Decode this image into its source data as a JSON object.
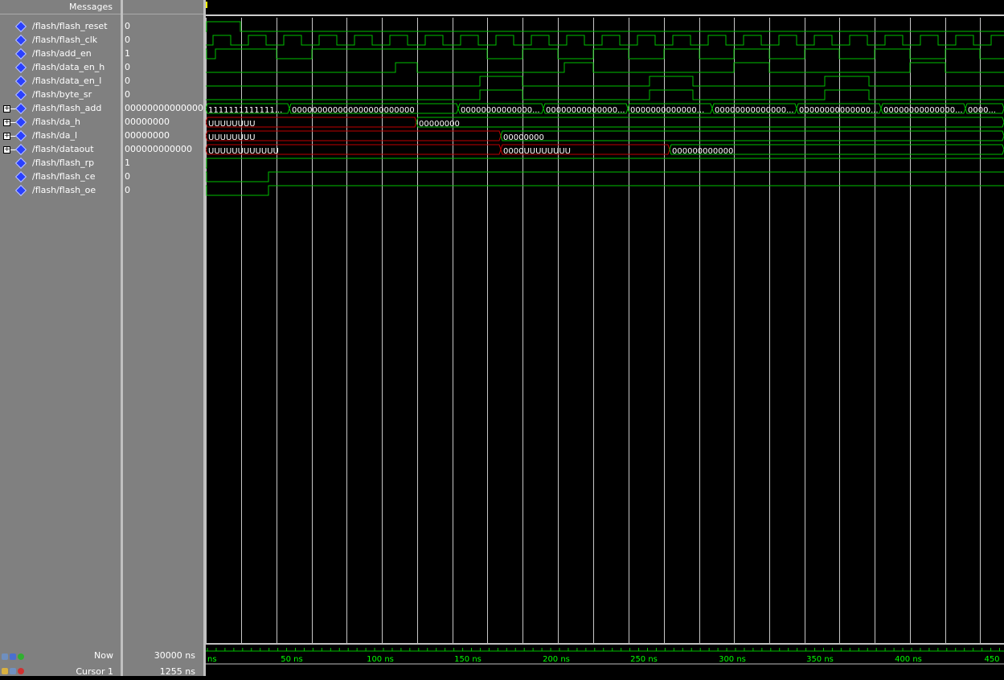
{
  "header": {
    "messages_label": "Messages"
  },
  "signals": [
    {
      "name": "/flash/flash_reset",
      "value": "0",
      "bus": false
    },
    {
      "name": "/flash/flash_clk",
      "value": "0",
      "bus": false
    },
    {
      "name": "/flash/add_en",
      "value": "1",
      "bus": false
    },
    {
      "name": "/flash/data_en_h",
      "value": "0",
      "bus": false
    },
    {
      "name": "/flash/data_en_l",
      "value": "0",
      "bus": false
    },
    {
      "name": "/flash/byte_sr",
      "value": "0",
      "bus": false
    },
    {
      "name": "/flash/flash_add",
      "value": "0000000000000000000",
      "bus": true
    },
    {
      "name": "/flash/da_h",
      "value": "00000000",
      "bus": true
    },
    {
      "name": "/flash/da_l",
      "value": "00000000",
      "bus": true
    },
    {
      "name": "/flash/dataout",
      "value": "000000000000",
      "bus": true
    },
    {
      "name": "/flash/flash_rp",
      "value": "1",
      "bus": false
    },
    {
      "name": "/flash/flash_ce",
      "value": "0",
      "bus": false
    },
    {
      "name": "/flash/flash_oe",
      "value": "0",
      "bus": false
    }
  ],
  "bus_labels": {
    "flash_add": [
      "1111111111111...",
      "000000000000000000000000",
      "00000000000000...",
      "00000000000000...",
      "0000000000000...",
      "00000000000000...",
      "00000000000000...",
      "00000000000000...",
      "0000..."
    ],
    "da_h": [
      "UUUUUUUU",
      "00000000"
    ],
    "da_l": [
      "UUUUUUUU",
      "00000000"
    ],
    "dataout": [
      "UUUUUUUUUUUU",
      "0000UUUUUUUU",
      "000000000000"
    ]
  },
  "footer": {
    "now_label": "Now",
    "now_value": "30000 ns",
    "cursor_label": "Cursor 1",
    "cursor_value": "1255 ns"
  },
  "timeline": {
    "unit": "ns",
    "ticks": [
      "ns",
      "50 ns",
      "100 ns",
      "150 ns",
      "200 ns",
      "250 ns",
      "300 ns",
      "350 ns",
      "400 ns",
      "450"
    ]
  },
  "colors": {
    "wave": "#00c000",
    "bus_undefined": "#c00000",
    "grid": "#ffffff",
    "ticks": "#00ff00"
  }
}
